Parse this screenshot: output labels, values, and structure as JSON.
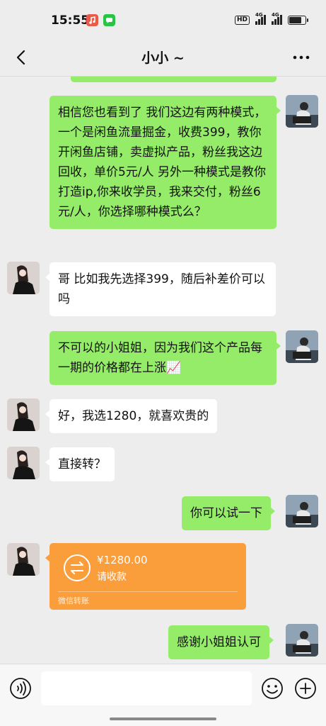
{
  "status_bar": {
    "time": "15:55",
    "hd_label": "HD",
    "network_1": "4G",
    "network_2": "4G"
  },
  "header": {
    "title": "小小 ~"
  },
  "messages": [
    {
      "from": "me",
      "text": "相信您也看到了 我们这边有两种模式，一个是闲鱼流量掘金，收费399，教你开闲鱼店铺，卖虚拟产品，粉丝我这边回收，单价5元/人 另外一种模式是教你打造ip,你来收学员，我来交付，粉丝6元/人，你选择哪种模式么？"
    },
    {
      "from": "other",
      "text": "哥 比如我先选择399，随后补差价可以吗"
    },
    {
      "from": "me",
      "text": "不可以的小姐姐，因为我们这个产品每一期的价格都在上涨📈"
    },
    {
      "from": "other",
      "text": "好，我选1280，就喜欢贵的"
    },
    {
      "from": "other",
      "text": "直接转？"
    },
    {
      "from": "me",
      "text": "你可以试一下"
    },
    {
      "from": "other",
      "type": "transfer",
      "amount": "¥1280.00",
      "status": "请收款",
      "footer": "微信转账"
    },
    {
      "from": "me",
      "text": "感谢小姐姐认可"
    }
  ],
  "colors": {
    "my_bubble": "#95ec69",
    "their_bubble": "#ffffff",
    "transfer_card": "#fa9d3b",
    "background": "#ededed"
  },
  "icons": {
    "back": "chevron-left-icon",
    "more": "more-dots-icon",
    "voice": "voice-icon",
    "emoji": "emoji-icon",
    "plus": "plus-icon",
    "transfer": "transfer-arrows-icon"
  }
}
